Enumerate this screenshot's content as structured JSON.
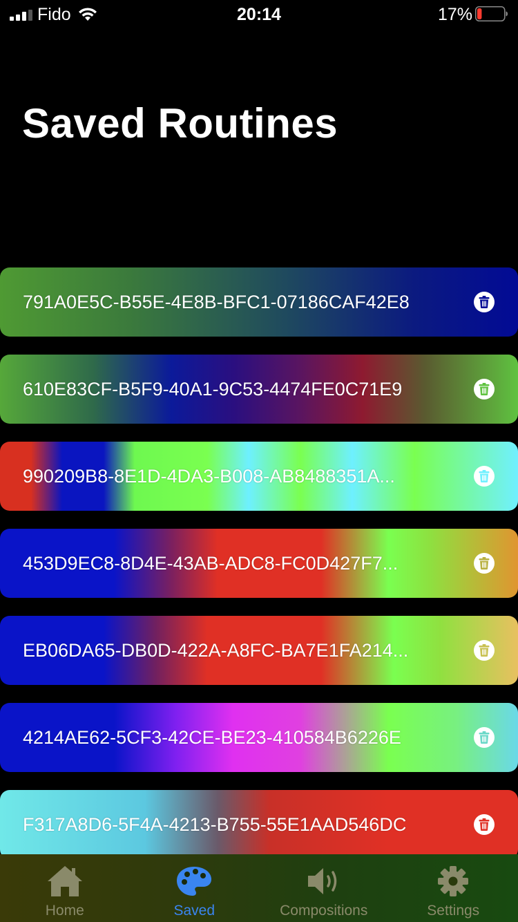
{
  "status_bar": {
    "carrier": "Fido",
    "time": "20:14",
    "battery_percent": "17%",
    "battery_level": 0.17
  },
  "page": {
    "title": "Saved Routines"
  },
  "routines": [
    {
      "name": "791A0E5C-B55E-4E8B-BFC1-07186CAF42E8",
      "delete_icon_color": "#020a95"
    },
    {
      "name": "610E83CF-B5F9-40A1-9C53-4474FE0C71E9",
      "delete_icon_color": "#5fc240"
    },
    {
      "name": "990209B8-8E1D-4DA3-B008-AB8488351A...",
      "delete_icon_color": "#70f0ff"
    },
    {
      "name": "453D9EC8-8D4E-43AB-ADC8-FC0D427F7...",
      "delete_icon_color": "#b8b040"
    },
    {
      "name": "EB06DA65-DB0D-422A-A8FC-BA7E1FA214...",
      "delete_icon_color": "#c8c050"
    },
    {
      "name": "4214AE62-5CF3-42CE-BE23-410584B6226E",
      "delete_icon_color": "#6ad8c8"
    },
    {
      "name": "F317A8D6-5F4A-4213-B755-55E1AAD546DC",
      "delete_icon_color": "#e03025"
    }
  ],
  "tab_bar": {
    "tabs": [
      {
        "label": "Home",
        "icon": "house-icon"
      },
      {
        "label": "Saved",
        "icon": "palette-icon"
      },
      {
        "label": "Compositions",
        "icon": "speaker-icon"
      },
      {
        "label": "Settings",
        "icon": "gear-icon"
      }
    ],
    "active_index": 1,
    "active_color": "#3a85f0",
    "inactive_color": "#8a8a6a"
  }
}
